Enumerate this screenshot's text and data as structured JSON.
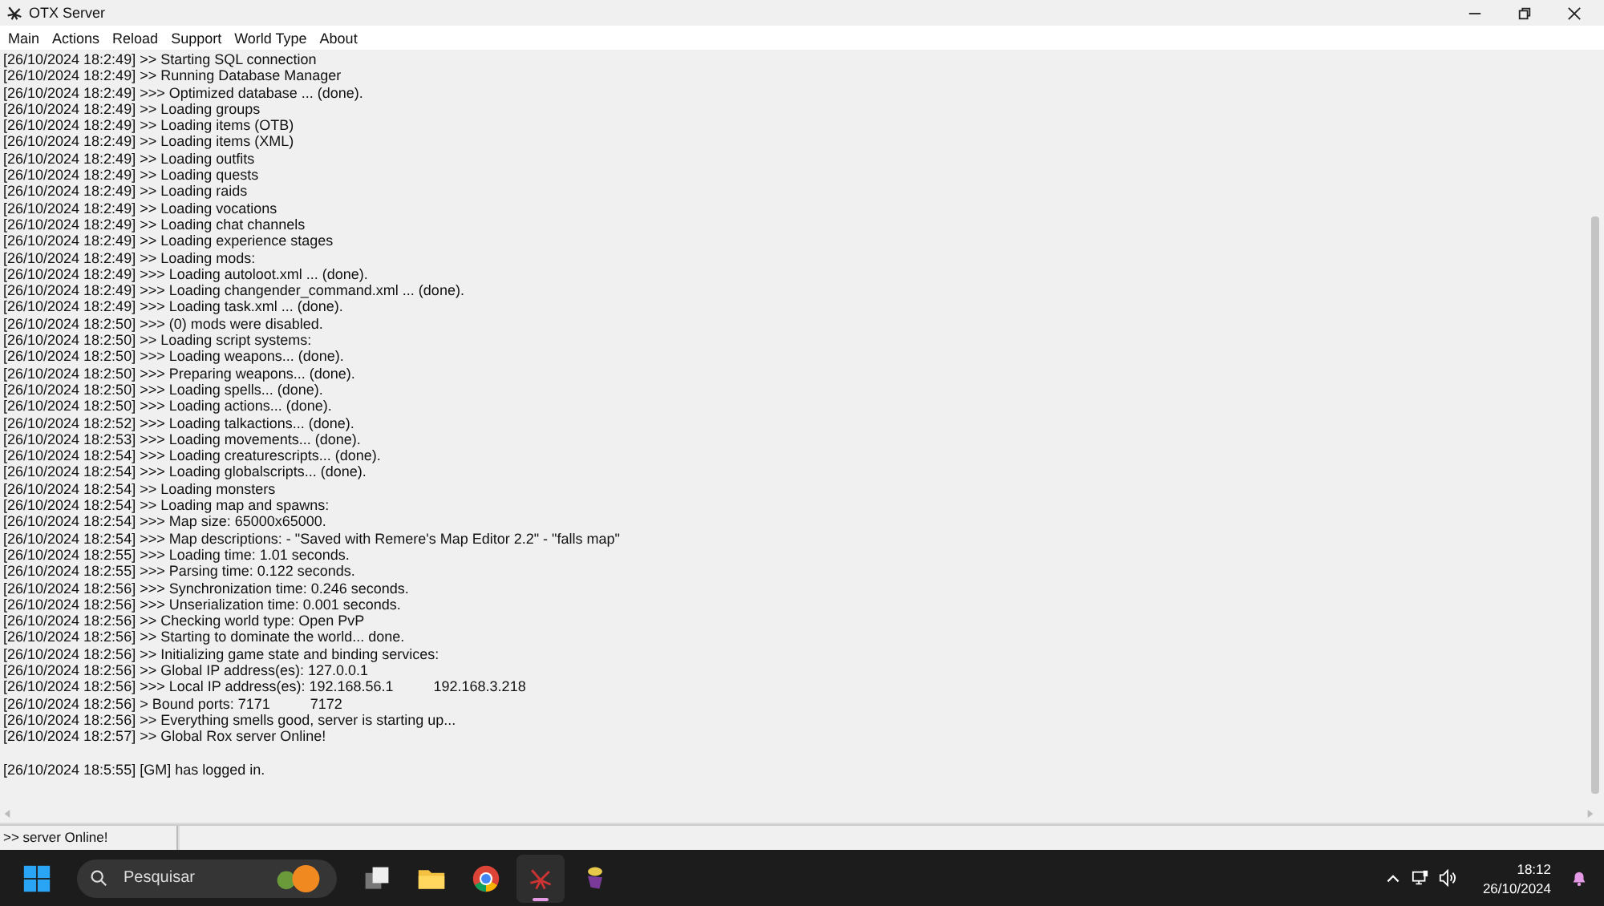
{
  "window": {
    "title": "OTX Server"
  },
  "menu": [
    "Main",
    "Actions",
    "Reload",
    "Support",
    "World Type",
    "About"
  ],
  "log": [
    "[26/10/2024 18:2:49] >> Starting SQL connection",
    "[26/10/2024 18:2:49] >> Running Database Manager",
    "[26/10/2024 18:2:49] >>> Optimized database ... (done).",
    "[26/10/2024 18:2:49] >> Loading groups",
    "[26/10/2024 18:2:49] >> Loading items (OTB)",
    "[26/10/2024 18:2:49] >> Loading items (XML)",
    "[26/10/2024 18:2:49] >> Loading outfits",
    "[26/10/2024 18:2:49] >> Loading quests",
    "[26/10/2024 18:2:49] >> Loading raids",
    "[26/10/2024 18:2:49] >> Loading vocations",
    "[26/10/2024 18:2:49] >> Loading chat channels",
    "[26/10/2024 18:2:49] >> Loading experience stages",
    "[26/10/2024 18:2:49] >> Loading mods:",
    "[26/10/2024 18:2:49] >>> Loading autoloot.xml ... (done).",
    "[26/10/2024 18:2:49] >>> Loading changender_command.xml ... (done).",
    "[26/10/2024 18:2:49] >>> Loading task.xml ... (done).",
    "[26/10/2024 18:2:50] >>> (0) mods were disabled.",
    "[26/10/2024 18:2:50] >> Loading script systems:",
    "[26/10/2024 18:2:50] >>> Loading weapons... (done).",
    "[26/10/2024 18:2:50] >>> Preparing weapons... (done).",
    "[26/10/2024 18:2:50] >>> Loading spells... (done).",
    "[26/10/2024 18:2:50] >>> Loading actions... (done).",
    "[26/10/2024 18:2:52] >>> Loading talkactions... (done).",
    "[26/10/2024 18:2:53] >>> Loading movements... (done).",
    "[26/10/2024 18:2:54] >>> Loading creaturescripts... (done).",
    "[26/10/2024 18:2:54] >>> Loading globalscripts... (done).",
    "[26/10/2024 18:2:54] >> Loading monsters",
    "[26/10/2024 18:2:54] >> Loading map and spawns:",
    "[26/10/2024 18:2:54] >>> Map size: 65000x65000.",
    "[26/10/2024 18:2:54] >>> Map descriptions: - \"Saved with Remere's Map Editor 2.2\" - \"falls map\"",
    "[26/10/2024 18:2:55] >>> Loading time: 1.01 seconds.",
    "[26/10/2024 18:2:55] >>> Parsing time: 0.122 seconds.",
    "[26/10/2024 18:2:56] >>> Synchronization time: 0.246 seconds.",
    "[26/10/2024 18:2:56] >>> Unserialization time: 0.001 seconds.",
    "[26/10/2024 18:2:56] >> Checking world type: Open PvP",
    "[26/10/2024 18:2:56] >> Starting to dominate the world... done.",
    "[26/10/2024 18:2:56] >> Initializing game state and binding services:",
    "[26/10/2024 18:2:56] >> Global IP address(es): 127.0.0.1",
    "[26/10/2024 18:2:56] >>> Local IP address(es): 192.168.56.1          192.168.3.218",
    "[26/10/2024 18:2:56] > Bound ports: 7171          7172",
    "[26/10/2024 18:2:56] >> Everything smells good, server is starting up...",
    "[26/10/2024 18:2:57] >> Global Rox server Online!"
  ],
  "events": [
    "[26/10/2024 18:5:55] [GM] has logged in."
  ],
  "status_bar": {
    "message": ">> server Online!"
  },
  "taskbar": {
    "search": {
      "placeholder": "Pesquisar"
    },
    "apps": [
      {
        "kind": "windows",
        "selected": false
      },
      {
        "kind": "taskview",
        "selected": false
      },
      {
        "kind": "folder",
        "selected": false
      },
      {
        "kind": "chrome",
        "selected": false
      },
      {
        "kind": "otx",
        "selected": true
      },
      {
        "kind": "game",
        "selected": false
      }
    ],
    "time": "18:12",
    "date": "26/10/2024"
  }
}
